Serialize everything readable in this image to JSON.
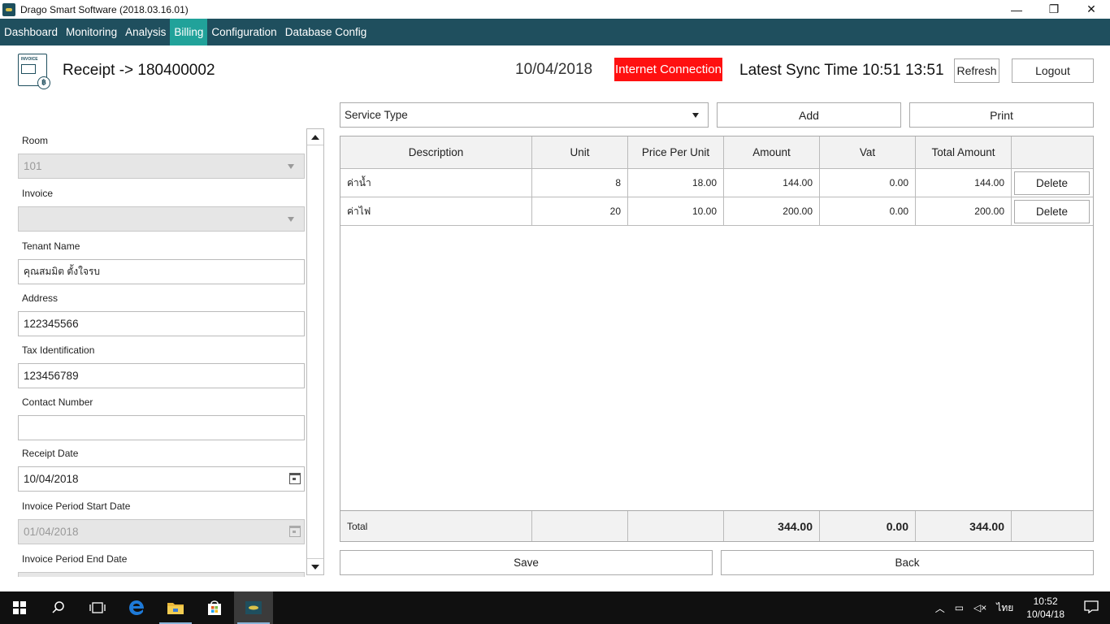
{
  "window": {
    "title": "Drago Smart Software (2018.03.16.01)",
    "minimize": "—",
    "restore": "❐",
    "close": "✕"
  },
  "menu": {
    "items": [
      {
        "label": "Dashboard",
        "active": false
      },
      {
        "label": "Monitoring",
        "active": false
      },
      {
        "label": "Analysis",
        "active": false
      },
      {
        "label": "Billing",
        "active": true
      },
      {
        "label": "Configuration",
        "active": false
      },
      {
        "label": "Database Config",
        "active": false
      }
    ]
  },
  "header": {
    "icon_text": "INVOICE",
    "icon_coin": "฿",
    "title": "Receipt -> 180400002",
    "date": "10/04/2018",
    "connection_status": "Internet Connection",
    "sync": "Latest Sync Time 10:51",
    "time": "13:51",
    "refresh_label": "Refresh",
    "logout_label": "Logout"
  },
  "colors": {
    "menu_bg": "#1f4f5e",
    "menu_active": "#21a29a",
    "connection_bg": "#ff1010"
  },
  "form": {
    "room_label": "Room",
    "room_value": "101",
    "invoice_label": "Invoice",
    "invoice_value": "",
    "tenant_label": "Tenant Name",
    "tenant_value": "คุณสมมิต  ตั้งใจรบ",
    "address_label": "Address",
    "address_value": "122345566",
    "tax_label": "Tax Identification",
    "tax_value": "123456789",
    "contact_label": "Contact Number",
    "contact_value": "",
    "receipt_date_label": "Receipt Date",
    "receipt_date_value": "10/04/2018",
    "period_start_label": "Invoice Period Start Date",
    "period_start_value": "01/04/2018",
    "period_end_label": "Invoice Period End Date"
  },
  "toolbar": {
    "service_type_placeholder": "Service Type",
    "add_label": "Add",
    "print_label": "Print"
  },
  "table": {
    "columns": [
      "Description",
      "Unit",
      "Price Per Unit",
      "Amount",
      "Vat",
      "Total Amount"
    ],
    "rows": [
      {
        "description": "ค่าน้ำ",
        "unit": "8",
        "price": "18.00",
        "amount": "144.00",
        "vat": "0.00",
        "total": "144.00",
        "action": "Delete"
      },
      {
        "description": "ค่าไฟ",
        "unit": "20",
        "price": "10.00",
        "amount": "200.00",
        "vat": "0.00",
        "total": "200.00",
        "action": "Delete"
      }
    ],
    "footer": {
      "label": "Total",
      "amount": "344.00",
      "vat": "0.00",
      "total": "344.00"
    }
  },
  "actions": {
    "save_label": "Save",
    "back_label": "Back"
  },
  "taskbar": {
    "language": "ไทย",
    "clock_time": "10:52",
    "clock_date": "10/04/18"
  }
}
